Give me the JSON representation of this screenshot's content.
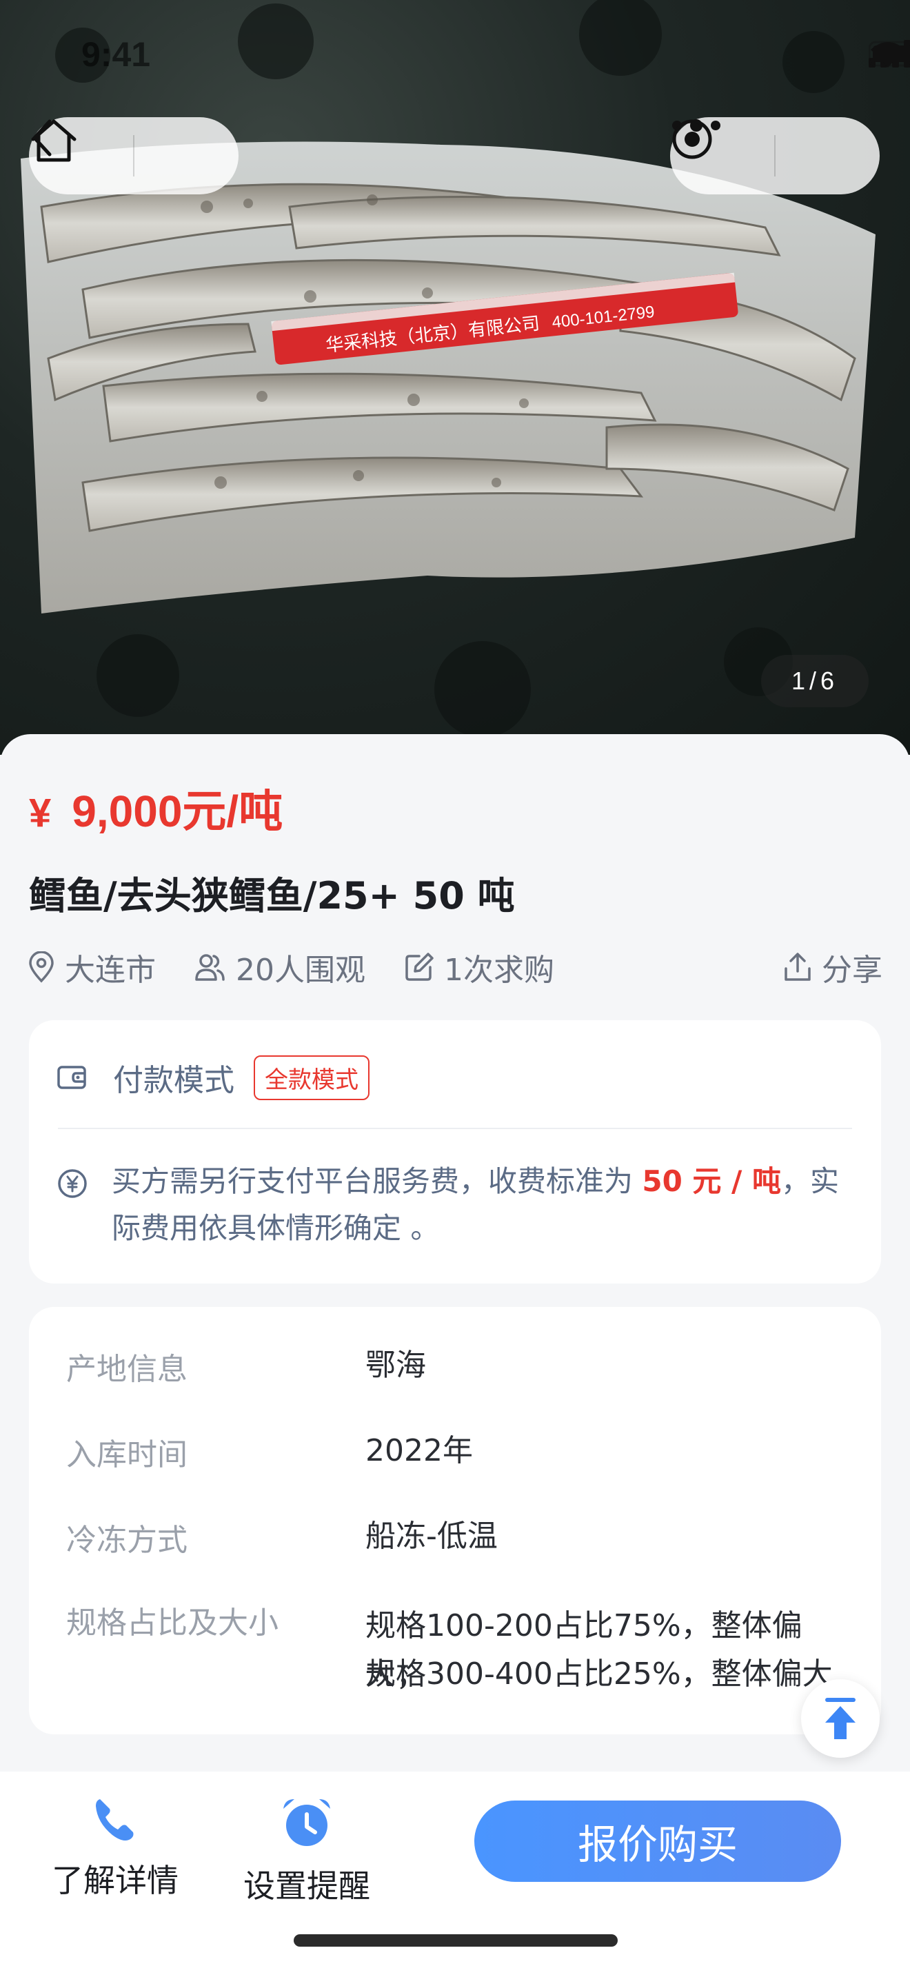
{
  "status_bar": {
    "time": "9:41"
  },
  "gallery": {
    "current": "1",
    "separator": "/",
    "total": "6"
  },
  "product": {
    "price_symbol": "¥",
    "price": "9,000元/吨",
    "title": "鳕鱼/去头狭鳕鱼/25+ 50 吨"
  },
  "meta": {
    "location": "大连市",
    "viewers": "20人围观",
    "requests": "1次求购",
    "share": "分享"
  },
  "payment": {
    "label": "付款模式",
    "badge": "全款模式",
    "fee_prefix": "买方需另行支付平台服务费，收费标准为 ",
    "fee_highlight": "50 元 / 吨",
    "fee_suffix": "，实际费用依具体情形确定 。"
  },
  "info": {
    "origin_label": "产地信息",
    "origin_value": "鄂海",
    "storage_label": "入库时间",
    "storage_value": "2022年",
    "freeze_label": "冷冻方式",
    "freeze_value": "船冻-低温",
    "spec_label": "规格占比及大小",
    "spec_value_1": "规格100-200占比75%，整体偏大；",
    "spec_value_2": "规格300-400占比25%，整体偏大"
  },
  "bottom": {
    "detail": "了解详情",
    "remind": "设置提醒",
    "buy": "报价购买"
  },
  "photo_label": {
    "brand": "华采科技（北京）有限公司",
    "phone": "400-101-2799"
  },
  "colors": {
    "price_red": "#e8382f",
    "accent_blue": "#4a8ff5"
  }
}
